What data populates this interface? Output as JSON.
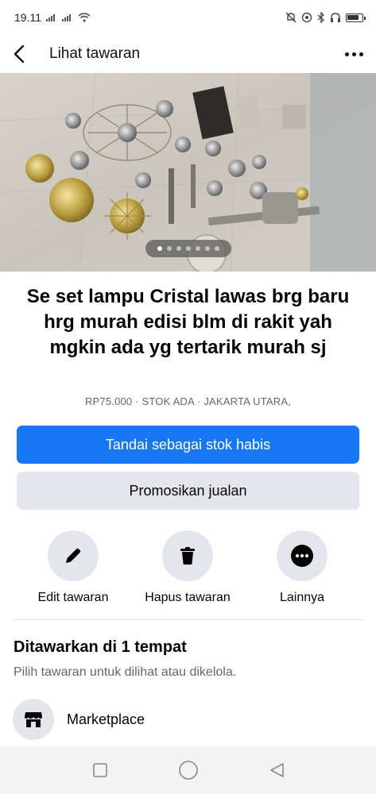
{
  "status_bar": {
    "time": "19.11",
    "battery_level": 0.8,
    "icons": [
      "signal-icon",
      "signal-icon",
      "wifi-icon",
      "mute-icon",
      "alarm-icon",
      "bluetooth-icon",
      "headphone-icon",
      "battery-icon"
    ]
  },
  "header": {
    "title": "Lihat tawaran",
    "back_icon": "back-arrow-icon",
    "more_icon": "more-horizontal-icon"
  },
  "photo": {
    "carousel_total": 7,
    "carousel_active_index": 0
  },
  "listing": {
    "title": "Se set lampu Cristal lawas brg baru hrg murah edisi blm di rakit yah mgkin ada yg tertarik murah sj",
    "meta": "RP75.000 · STOK ADA · JAKARTA UTARA,"
  },
  "buttons": {
    "mark_sold_label": "Tandai sebagai stok habis",
    "promote_label": "Promosikan jualan"
  },
  "actions": {
    "edit_label": "Edit tawaran",
    "delete_label": "Hapus tawaran",
    "more_label": "Lainnya"
  },
  "offered": {
    "title": "Ditawarkan di 1 tempat",
    "subtitle": "Pilih tawaran untuk dilihat atau dikelola.",
    "places": [
      {
        "label": "Marketplace",
        "icon": "marketplace-store-icon"
      }
    ]
  },
  "colors": {
    "primary": "#1877f2",
    "secondary_bg": "#e4e6eb",
    "muted_text": "#65676b"
  }
}
